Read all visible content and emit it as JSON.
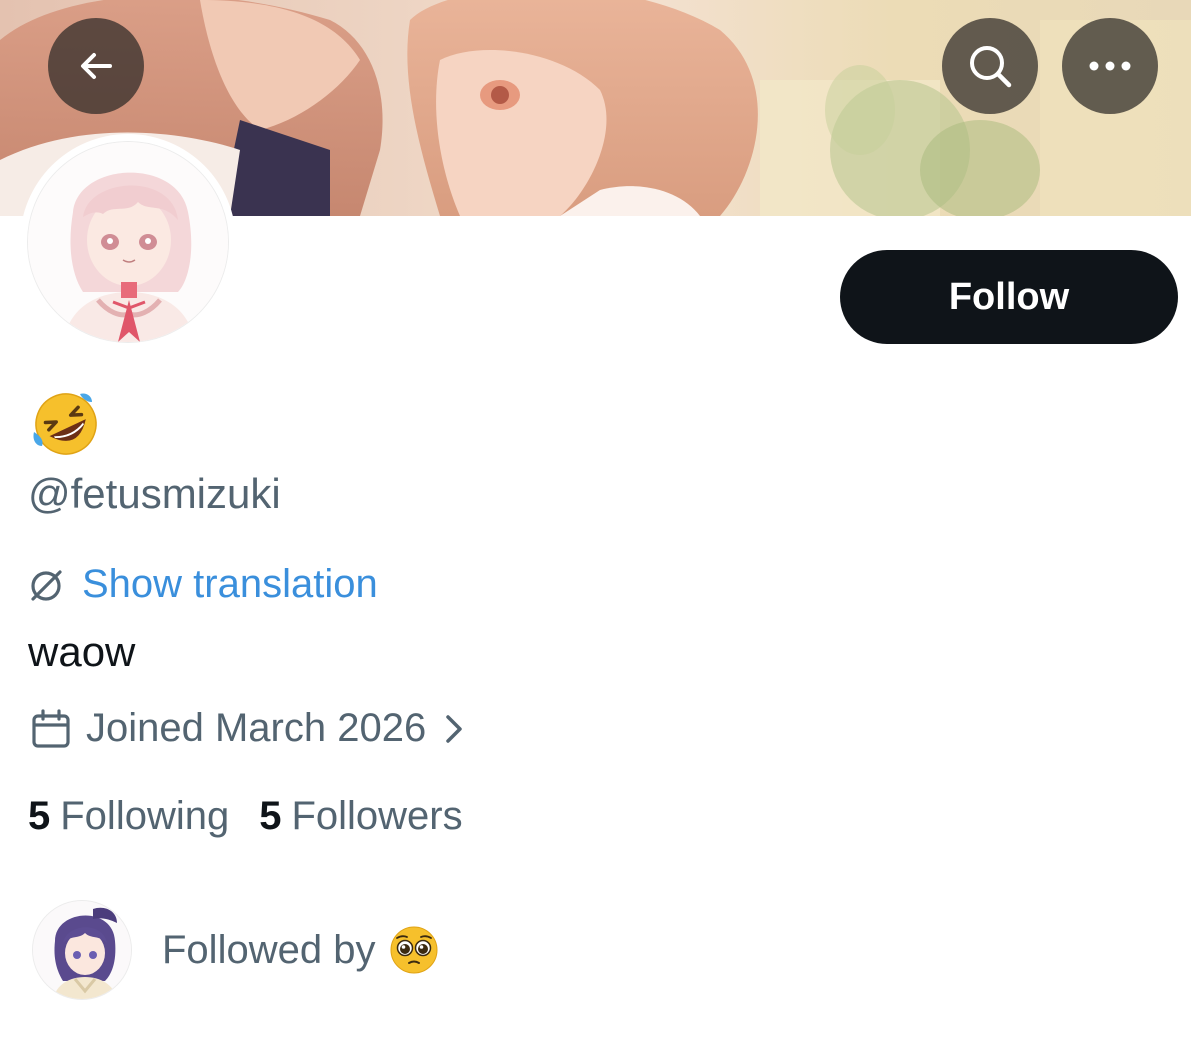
{
  "header": {
    "back_icon": "arrow-left-icon",
    "search_icon": "search-icon",
    "more_icon": "more-dots-icon",
    "banner": "anime-illustration-banner"
  },
  "profile": {
    "display_name_emoji": "rolling-on-floor-laughing-emoji",
    "handle": "@fetusmizuki",
    "follow_label": "Follow",
    "translation_label": "Show translation",
    "bio": "waow",
    "joined": "Joined March 2026",
    "following_count": "5",
    "following_label": "Following",
    "followers_count": "5",
    "followers_label": "Followers",
    "followed_by_label": "Followed by",
    "followed_by_emoji": "pleading-face-emoji"
  },
  "colors": {
    "follow_button_bg": "#0f1419",
    "link": "#3a8fdc",
    "secondary_text": "#536471",
    "primary_text": "#0f1419"
  }
}
